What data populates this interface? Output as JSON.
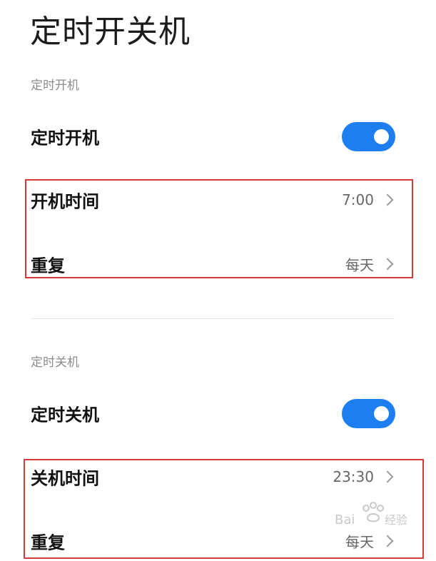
{
  "page": {
    "title": "定时开关机"
  },
  "power_on": {
    "section_title": "定时开机",
    "toggle": {
      "label": "定时开机",
      "checked": true
    },
    "time": {
      "label": "开机时间",
      "value": "7:00"
    },
    "repeat": {
      "label": "重复",
      "value": "每天"
    }
  },
  "power_off": {
    "section_title": "定时关机",
    "toggle": {
      "label": "定时关机",
      "checked": true
    },
    "time": {
      "label": "关机时间",
      "value": "23:30"
    },
    "repeat": {
      "label": "重复",
      "value": "每天"
    }
  },
  "theme": {
    "toggle_on_color": "#1d7ef2",
    "highlight_color": "#d43a3a"
  },
  "watermark": {
    "brand": "Bai du 经验",
    "icon": "paw-icon"
  }
}
